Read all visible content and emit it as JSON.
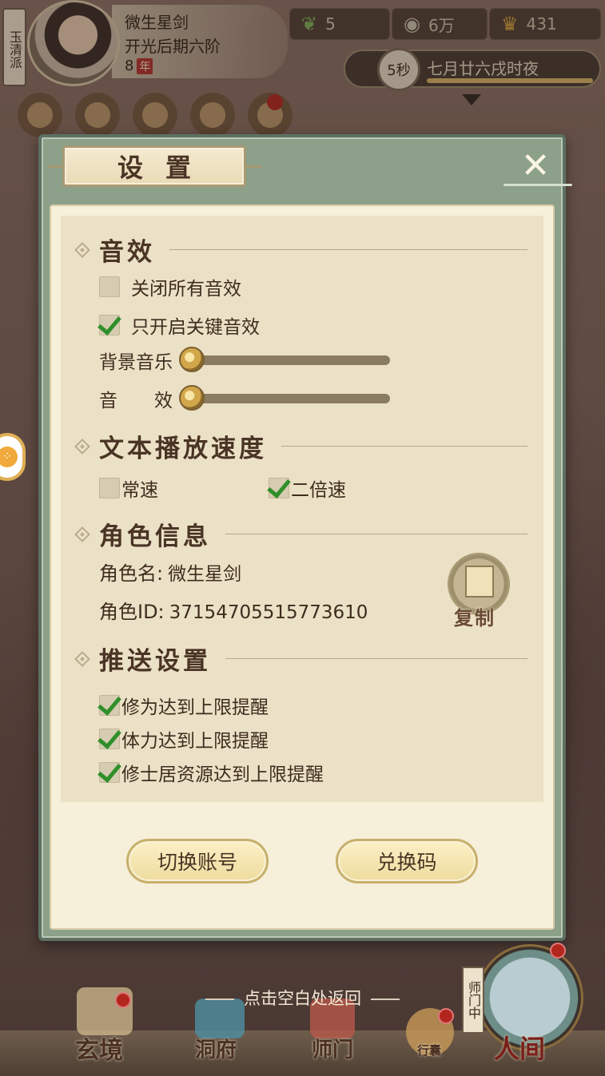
{
  "hud": {
    "sect": "玉清派",
    "player_name": "微生星剑",
    "realm": "开光后期六阶",
    "age_value": "8",
    "age_unit": "年",
    "resources": [
      {
        "icon": "leaf-icon",
        "value": "5"
      },
      {
        "icon": "coin-icon",
        "value": "6万"
      },
      {
        "icon": "ingot-icon",
        "value": "431"
      }
    ],
    "time_seconds": "5秒",
    "time_text": "七月廿六戌时夜"
  },
  "dialog": {
    "title": "设置",
    "close_glyph": "✕",
    "sections": {
      "sound": {
        "title": "音效",
        "options": [
          {
            "label": "关闭所有音效",
            "checked": false
          },
          {
            "label": "只开启关键音效",
            "checked": true
          }
        ],
        "sliders": [
          {
            "label": "背景音乐",
            "value": 0
          },
          {
            "label": "音　　效",
            "value": 0
          }
        ]
      },
      "text_speed": {
        "title": "文本播放速度",
        "options": [
          {
            "label": "常速",
            "checked": false
          },
          {
            "label": "二倍速",
            "checked": true
          }
        ]
      },
      "role_info": {
        "title": "角色信息",
        "name_label": "角色名:",
        "name_value": "微生星剑",
        "id_label": "角色ID:",
        "id_value": "37154705515773610",
        "copy_label": "复制"
      },
      "push": {
        "title": "推送设置",
        "options": [
          {
            "label": "修为达到上限提醒",
            "checked": true
          },
          {
            "label": "体力达到上限提醒",
            "checked": true
          },
          {
            "label": "修士居资源达到上限提醒",
            "checked": true
          }
        ]
      }
    },
    "buttons": {
      "switch_account": "切换账号",
      "redeem_code": "兑换码"
    }
  },
  "hint": "点击空白处返回",
  "bottom_nav": {
    "items": [
      "玄境",
      "洞府",
      "师门",
      "行囊",
      "人间"
    ],
    "sect_flag": "师门中"
  },
  "colors": {
    "dialog_frame": "#8ca08a",
    "panel": "#ebe1c6",
    "check_green": "#2f8f2a",
    "accent_red": "#b3261e",
    "text_brown": "#4a3425"
  }
}
